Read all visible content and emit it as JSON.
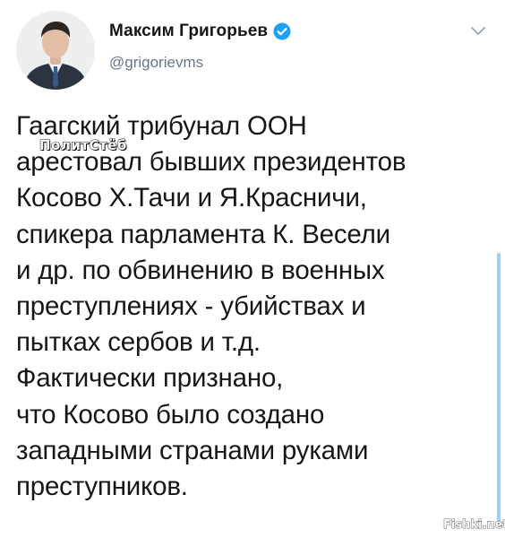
{
  "author": {
    "display_name": "Максим Григорьев",
    "handle": "@grigorievms",
    "verified": true,
    "avatar_icon": "person-portrait-photo"
  },
  "menu": {
    "icon": "chevron-down-icon"
  },
  "tweet": {
    "text": "Гаагский трибунал ООН\nарестовал бывших президентов\nКосово Х.Тачи и Я.Красничи,\nспикера парламента К. Весели\nи др. по обвинению в военных\nпреступлениях - убийствах и\nпытках сербов и т.д.\nФактически признано,\nчто Косово было создано\nзападными странами руками\nпреступников."
  },
  "watermarks": {
    "top": "ПолитСтёб",
    "bottom": "Fishki.net"
  },
  "colors": {
    "text": "#14171a",
    "secondary": "#657786",
    "verified": "#1da1f2",
    "scrollbar": "#9fd0f3"
  }
}
